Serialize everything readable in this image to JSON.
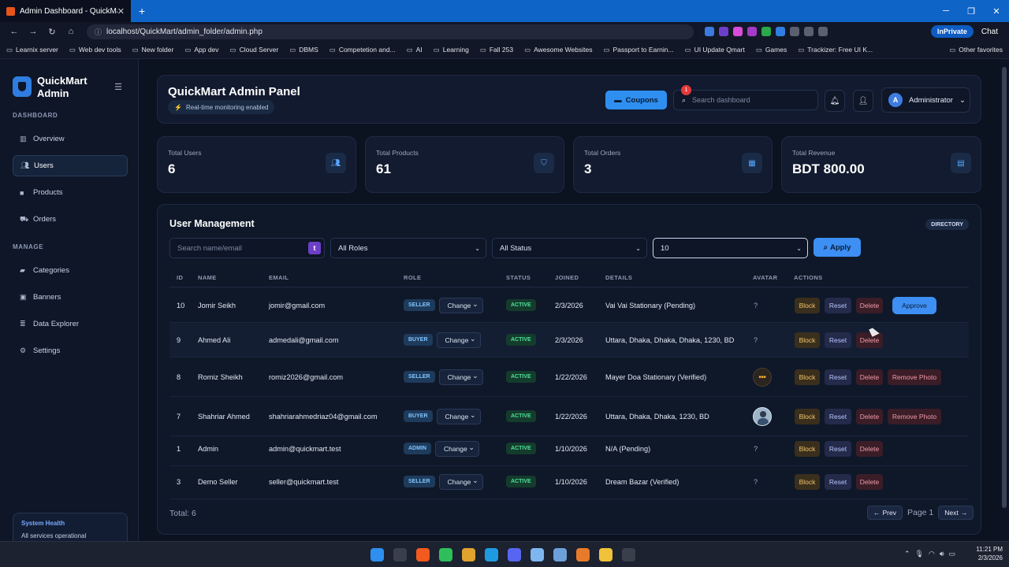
{
  "browser": {
    "tab_title": "Admin Dashboard - QuickMart",
    "url": "localhost/QuickMart/admin_folder/admin.php",
    "inprivate": "InPrivate",
    "chat": "Chat",
    "bookmarks": [
      "Learnix server",
      "Web dev tools",
      "New folder",
      "App dev",
      "Cloud Server",
      "DBMS",
      "Competetion and...",
      "AI",
      "Learning",
      "Fall 253",
      "Awesome Websites",
      "Passport to Earnin...",
      "UI Update Qmart",
      "Games",
      "Trackizer: Free UI K..."
    ],
    "other_favorites": "Other favorites"
  },
  "sidebar": {
    "brand": "QuickMart Admin",
    "section_dashboard": "DASHBOARD",
    "section_manage": "MANAGE",
    "dashboard_items": [
      {
        "label": "Overview",
        "icon": "chart-icon"
      },
      {
        "label": "Users",
        "icon": "users-icon"
      },
      {
        "label": "Products",
        "icon": "box-icon"
      },
      {
        "label": "Orders",
        "icon": "cart-icon"
      }
    ],
    "manage_items": [
      {
        "label": "Categories",
        "icon": "folder-icon"
      },
      {
        "label": "Banners",
        "icon": "image-icon"
      },
      {
        "label": "Data Explorer",
        "icon": "database-icon"
      },
      {
        "label": "Settings",
        "icon": "gear-icon"
      }
    ],
    "health_title": "System Health",
    "health_text": "All services operational"
  },
  "header": {
    "title": "QuickMart Admin Panel",
    "realtime": "Real-time monitoring enabled",
    "coupons": "Coupons",
    "search_placeholder": "Search dashboard",
    "notif_count": "1",
    "admin_initial": "A",
    "admin_name": "Administrator"
  },
  "stats": [
    {
      "label": "Total Users",
      "value": "6"
    },
    {
      "label": "Total Products",
      "value": "61"
    },
    {
      "label": "Total Orders",
      "value": "3"
    },
    {
      "label": "Total Revenue",
      "value": "BDT 800.00"
    }
  ],
  "users": {
    "title": "User Management",
    "badge": "DIRECTORY",
    "search_placeholder": "Search name/email",
    "role_filter": "All Roles",
    "status_filter": "All Status",
    "per_page": "10",
    "apply": "Apply",
    "columns": [
      "ID",
      "NAME",
      "EMAIL",
      "ROLE",
      "STATUS",
      "JOINED",
      "DETAILS",
      "AVATAR",
      "ACTIONS"
    ],
    "change_label": "Change",
    "block": "Block",
    "reset": "Reset",
    "delete": "Delete",
    "remove_photo": "Remove Photo",
    "approve": "Approve",
    "rows": [
      {
        "id": "10",
        "name": "Jomir Seikh",
        "email": "jomir@gmail.com",
        "role": "SELLER",
        "status": "ACTIVE",
        "joined": "2/3/2026",
        "details": "Vai Vai Stationary (Pending)",
        "avatar": "?"
      },
      {
        "id": "9",
        "name": "Ahmed Ali",
        "email": "admedali@gmail.com",
        "role": "BUYER",
        "status": "ACTIVE",
        "joined": "2/3/2026",
        "details": "Uttara, Dhaka, Dhaka, Dhaka, 1230, BD",
        "avatar": "?"
      },
      {
        "id": "8",
        "name": "Romiz Sheikh",
        "email": "romiz2026@gmail.com",
        "role": "SELLER",
        "status": "ACTIVE",
        "joined": "1/22/2026",
        "details": "Mayer Doa Stationary (Verified)",
        "avatar": ""
      },
      {
        "id": "7",
        "name": "Shahriar Ahmed",
        "email": "shahriarahmedriaz04@gmail.com",
        "role": "BUYER",
        "status": "ACTIVE",
        "joined": "1/22/2026",
        "details": "Uttara, Dhaka, Dhaka, 1230, BD",
        "avatar": ""
      },
      {
        "id": "1",
        "name": "Admin",
        "email": "admin@quickmart.test",
        "role": "ADMIN",
        "status": "ACTIVE",
        "joined": "1/10/2026",
        "details": "N/A (Pending)",
        "avatar": "?"
      },
      {
        "id": "3",
        "name": "Demo Seller",
        "email": "seller@quickmart.test",
        "role": "SELLER",
        "status": "ACTIVE",
        "joined": "1/10/2026",
        "details": "Dream Bazar (Verified)",
        "avatar": "?"
      }
    ],
    "total": "Total: 6",
    "prev": "Prev",
    "page": "Page 1",
    "next": "Next"
  },
  "taskbar": {
    "time": "11:21 PM",
    "date": "2/3/2026"
  }
}
